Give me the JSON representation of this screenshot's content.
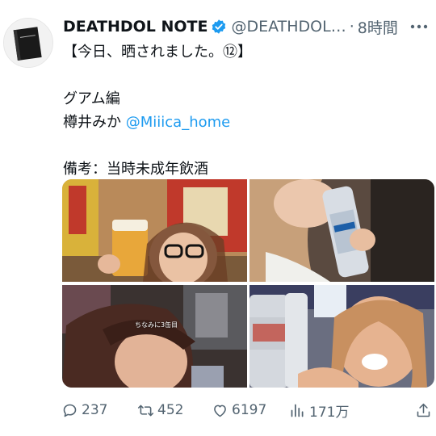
{
  "tweet": {
    "display_name": "DEATHDOL NOTE",
    "handle": "@DEATHDOL…",
    "separator": "·",
    "time": "8時間",
    "lines": [
      "【今日、晒されました。⑫】",
      "",
      "グアム編",
      "樽井みか ",
      "",
      "備考：当時未成年飲酒"
    ],
    "mention": "@Miiica_home",
    "image_caption": "ちなみに3缶目"
  },
  "icons": {
    "avatar": "death-note-book-icon",
    "verified": "verified-badge-icon",
    "more": "more-icon",
    "reply": "reply-icon",
    "retweet": "retweet-icon",
    "like": "heart-icon",
    "views": "views-icon",
    "share": "share-icon"
  },
  "actions": {
    "replies": "237",
    "retweets": "452",
    "likes": "6197",
    "views": "171万"
  },
  "colors": {
    "accent": "#1d9bf0",
    "muted": "#536471",
    "text": "#0f1419"
  }
}
